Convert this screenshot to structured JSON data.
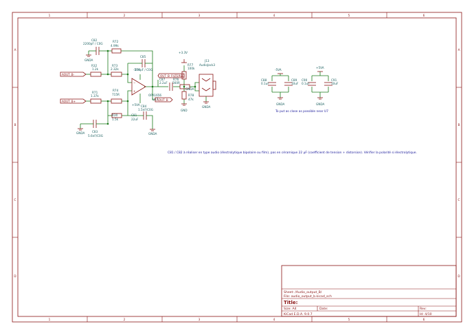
{
  "border": {
    "columns": [
      "1",
      "2",
      "3",
      "4",
      "5",
      "6"
    ],
    "rows": [
      "A",
      "B",
      "C",
      "D"
    ]
  },
  "labels": {
    "out_b_minus": "AOUT_B-",
    "out_b_plus": "AOUT_B+",
    "out_b_filtered": "OUT_B_FILTERED",
    "aout_b": "AOUT_B"
  },
  "components": {
    "c82": {
      "ref": "C82",
      "value": "2200pF / C0G"
    },
    "r72": {
      "ref": "R72",
      "value": "4.99k"
    },
    "r73": {
      "ref": "R73",
      "value": "2.32k"
    },
    "r32": {
      "ref": "R32",
      "value": "1.2k"
    },
    "c85": {
      "ref": "C85",
      "value": "270pF / C0G"
    },
    "r71": {
      "ref": "R71",
      "value": "1.37k"
    },
    "r74": {
      "ref": "R74",
      "value": "715R"
    },
    "r30": {
      "ref": "R30",
      "value": "1.5k"
    },
    "c83": {
      "ref": "C83",
      "value": "5.6nF/C0G"
    },
    "c84": {
      "ref": "C84",
      "value": "1.5nF/C0G"
    },
    "c81": {
      "ref": "C81",
      "value": "22uF"
    },
    "c87": {
      "ref": "C87",
      "value": "2.2uF"
    },
    "r76": {
      "ref": "R76",
      "value": "560R"
    },
    "r77": {
      "ref": "R77",
      "value": "100k"
    },
    "r78": {
      "ref": "R78",
      "value": "47k"
    },
    "u17": {
      "ref": "U17",
      "value": "OPA1656"
    },
    "j13": {
      "ref": "J13",
      "value": "AudioJack3"
    },
    "c88": {
      "ref": "C88",
      "value": "0.1uF"
    },
    "c89": {
      "ref": "C89",
      "value": "10uF"
    },
    "c90": {
      "ref": "C90",
      "value": "0.1uF"
    },
    "c91": {
      "ref": "C91",
      "value": "10uF"
    }
  },
  "power": {
    "gnda": "GNDA",
    "gnd": "GND",
    "v33": "+3.3V",
    "vneg": "-5VA",
    "vpos": "+5VA"
  },
  "notes": {
    "decoupling": "To put as close as possible near U7",
    "c81_note": "C81 / C82 à réaliser en type audio (électrolytique bipolaire ou film), pas en céramique 22 µF (coefficient de tension + distorsion). Vérifier la polarité si électrolytique."
  },
  "title_block": {
    "sheet": "Sheet: /Audio_output_B/",
    "file": "File: audio_output_b.kicad_sch",
    "title": "Title:",
    "size": "Size: A4",
    "date": "Date:",
    "rev": "Rev:",
    "tool": "KiCad E.D.A. 9.0.7",
    "id": "Id: 4/10"
  }
}
